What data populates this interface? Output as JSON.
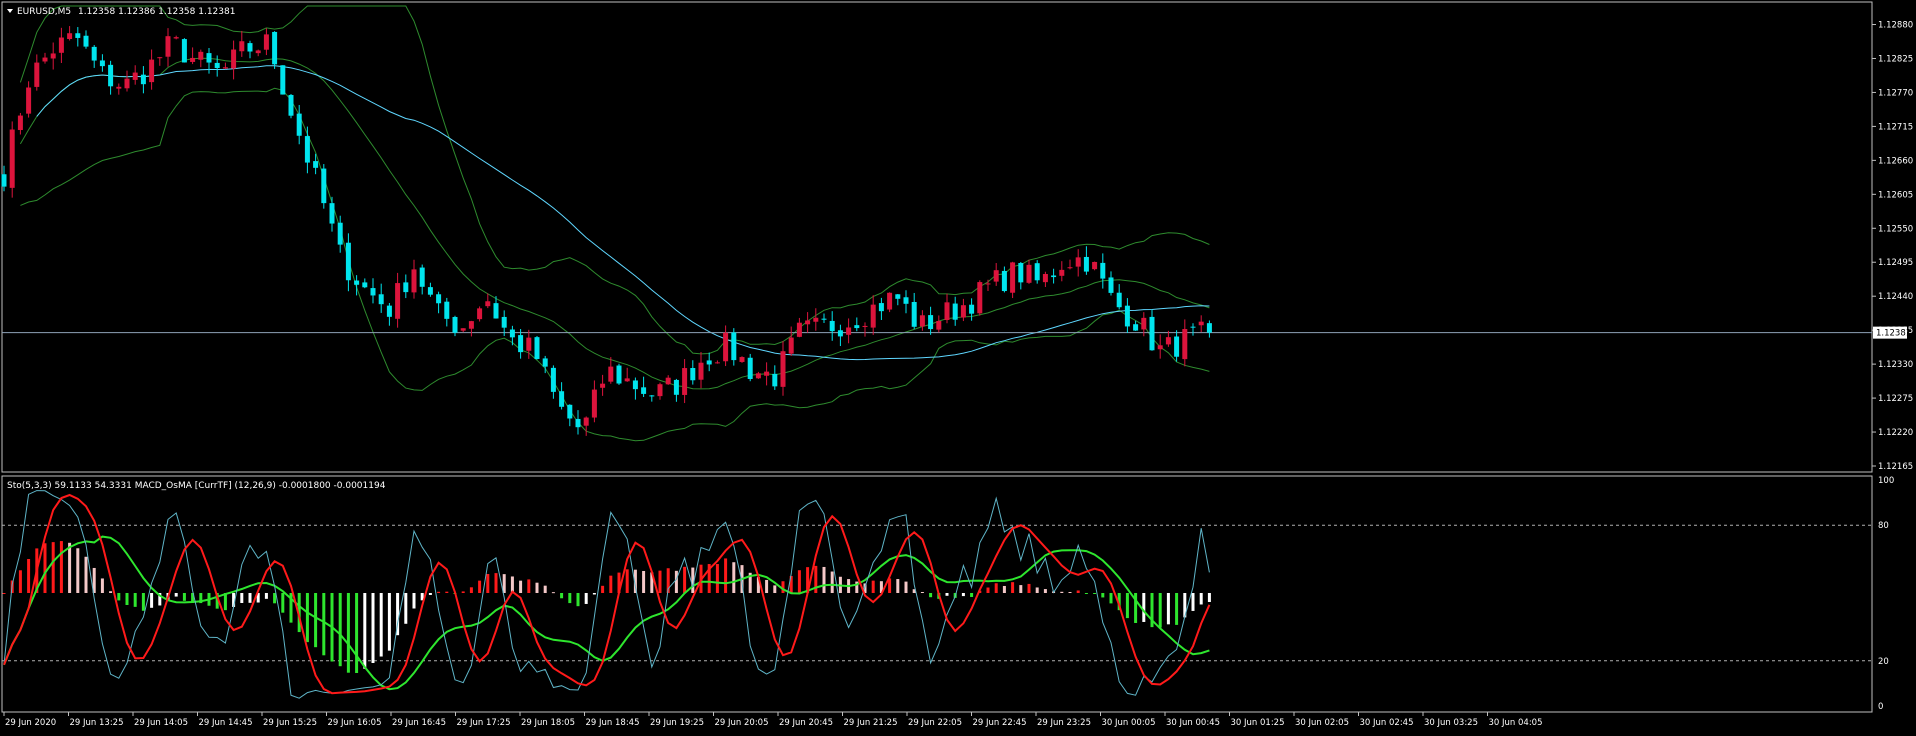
{
  "main_panel": {
    "header_symbol": "EURUSD,M5",
    "header_ohlc": "1.12358 1.12386 1.12358 1.12381",
    "current_price_label": "1.12381"
  },
  "sub_panel": {
    "header": "Sto(5,3,3) 59.1133 54.3331  MACD_OsMA [CurrTF] (12,26,9) -0.0001800 -0.0001194"
  },
  "colors": {
    "background": "#000000",
    "frame": "#c0c0c0",
    "bull_candle": "#dc143c",
    "bear_candle": "#00e5ee",
    "bollinger": "#2e8b2e",
    "moving_average": "#5fd7ff",
    "stoch_main": "#5fb5c8",
    "stoch_signal": "#ff1a1a",
    "macd_signal": "#2ee62e",
    "hist_pos": "#ff1a1a",
    "hist_neg": "#2ee62e",
    "hist_pale": "#f4c8c8"
  },
  "chart_data": [
    {
      "type": "candlestick",
      "symbol": "EURUSD",
      "timeframe": "M5",
      "ylim": [
        1.12165,
        1.1291
      ],
      "y_ticks": [
        "1.12880",
        "1.12825",
        "1.12770",
        "1.12715",
        "1.12660",
        "1.12605",
        "1.12550",
        "1.12495",
        "1.12440",
        "1.12385",
        "1.12330",
        "1.12275",
        "1.12220",
        "1.12165"
      ],
      "current_price": 1.12381,
      "series": [
        {
          "name": "price",
          "close_path": [
            1.1264,
            1.1279,
            1.1284,
            1.1286,
            1.128,
            1.1278,
            1.1281,
            1.1285,
            1.1282,
            1.128,
            1.1284,
            1.1285,
            1.1273,
            1.1262,
            1.125,
            1.1245,
            1.1242,
            1.1249,
            1.1241,
            1.1239,
            1.1244,
            1.1237,
            1.1235,
            1.1226,
            1.1222,
            1.1232,
            1.123,
            1.1228,
            1.123,
            1.1234,
            1.1236,
            1.1232,
            1.1231,
            1.1238,
            1.1239,
            1.124,
            1.1242,
            1.1244,
            1.1239,
            1.1241,
            1.1243,
            1.1246,
            1.1248,
            1.1246,
            1.125,
            1.125,
            1.1243,
            1.124,
            1.1235,
            1.1237,
            1.1238
          ]
        }
      ]
    },
    {
      "type": "oscillator",
      "ylim": [
        0,
        100
      ],
      "y_ticks": [
        "100",
        "80",
        "20",
        "0"
      ],
      "levels": [
        80,
        20
      ],
      "stochastic": {
        "k_period": 5,
        "d_period": 3,
        "slowing": 3,
        "main": 59.1133,
        "signal": 54.3331
      },
      "macd_osma": {
        "fast": 12,
        "slow": 26,
        "signal": 9,
        "osma": -0.00018,
        "signal_value": -0.0001194
      },
      "x_ticks": [
        "29 Jun 2020",
        "29 Jun 13:25",
        "29 Jun 14:05",
        "29 Jun 14:45",
        "29 Jun 15:25",
        "29 Jun 16:05",
        "29 Jun 16:45",
        "29 Jun 17:25",
        "29 Jun 18:05",
        "29 Jun 18:45",
        "29 Jun 19:25",
        "29 Jun 20:05",
        "29 Jun 20:45",
        "29 Jun 21:25",
        "29 Jun 22:05",
        "29 Jun 22:45",
        "29 Jun 23:25",
        "30 Jun 00:05",
        "30 Jun 00:45",
        "30 Jun 01:25",
        "30 Jun 02:05",
        "30 Jun 02:45",
        "30 Jun 03:25",
        "30 Jun 04:05"
      ]
    }
  ]
}
